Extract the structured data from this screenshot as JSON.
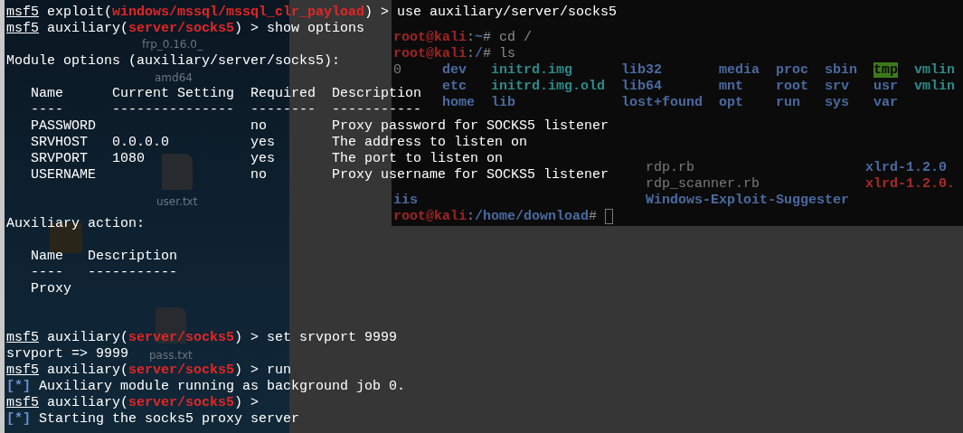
{
  "desktop": {
    "items": [
      {
        "kind": "none",
        "label": [
          "frp_0.16.0_"
        ]
      },
      {
        "kind": "none",
        "label": [
          "amd64"
        ]
      },
      {
        "kind": "file",
        "label": [
          "user.txt"
        ]
      },
      {
        "kind": "folder"
      },
      {
        "kind": "file",
        "label": [
          "pass.txt"
        ]
      }
    ]
  },
  "background_terminal": {
    "lines": [
      {
        "kind": "blank"
      },
      {
        "kind": "blank"
      },
      {
        "kind": "prompt",
        "user": "root@kali",
        "separator": ":",
        "path": "~",
        "command": "# cd /"
      },
      {
        "kind": "prompt",
        "user": "root@kali",
        "separator": ":",
        "path": "/",
        "command": "# ls"
      },
      {
        "kind": "grid",
        "rows": [
          {
            "column_1": {
              "text": "0",
              "kind": "file"
            },
            "column_2": {
              "text": "dev",
              "kind": "dir"
            },
            "column_3": {
              "text": "initrd.img",
              "kind": "link"
            },
            "column_4": {
              "text": "lib32",
              "kind": "dir"
            },
            "column_5": {
              "text": "media",
              "kind": "dir"
            },
            "column_6": {
              "text": "proc",
              "kind": "dir"
            },
            "column_7": {
              "text": "sbin",
              "kind": "dir"
            },
            "column_8": {
              "text": "tmp",
              "kind": "sticky"
            },
            "column_9": {
              "text": "vmlin",
              "kind": "link"
            }
          },
          {
            "column_2": {
              "text": "etc",
              "kind": "dir"
            },
            "column_3": {
              "text": "initrd.img.old",
              "kind": "link"
            },
            "column_4": {
              "text": "lib64",
              "kind": "dir"
            },
            "column_5": {
              "text": "mnt",
              "kind": "dir"
            },
            "column_6": {
              "text": "root",
              "kind": "dir"
            },
            "column_7": {
              "text": "srv",
              "kind": "dir"
            },
            "column_8": {
              "text": "usr",
              "kind": "dir"
            },
            "column_9": {
              "text": "vmlin",
              "kind": "link"
            }
          },
          {
            "column_2": {
              "text": "home",
              "kind": "dir"
            },
            "column_3": {
              "text": "lib",
              "kind": "dir"
            },
            "column_4": {
              "text": "lost+found",
              "kind": "dir"
            },
            "column_5": {
              "text": "opt",
              "kind": "dir"
            },
            "column_6": {
              "text": "run",
              "kind": "dir"
            },
            "column_7": {
              "text": "sys",
              "kind": "dir"
            },
            "column_8": {
              "text": "var",
              "kind": "dir"
            }
          }
        ]
      },
      {
        "kind": "blank"
      },
      {
        "kind": "blank"
      },
      {
        "kind": "blank"
      },
      {
        "kind": "grid",
        "rows": [
          {
            "column_2": {
              "text": "rdp.rb",
              "kind": "file"
            },
            "column_3": {
              "text": "xlrd-1.2.0",
              "kind": "dir"
            }
          },
          {
            "column_2": {
              "text": "rdp_scanner.rb",
              "kind": "file"
            },
            "column_3": {
              "text": "xlrd-1.2.0.",
              "kind": "archive"
            }
          },
          {
            "column_1": {
              "text": "iis",
              "kind": "dir"
            },
            "column_2": {
              "text": "Windows-Exploit-Suggester",
              "kind": "dir"
            }
          }
        ]
      },
      {
        "kind": "prompt",
        "user": "root@kali",
        "separator": ":",
        "path": "/home/download",
        "command": "# ",
        "cursor": true
      }
    ]
  },
  "terminal": {
    "lines": [
      {
        "kind": "prompt",
        "prompt": "msf5",
        "before": " exploit(",
        "module": "windows/mssql/mssql_clr_payload",
        "after": ") > use auxiliary/server/socks5"
      },
      {
        "kind": "prompt",
        "prompt": "msf5",
        "before": " auxiliary(",
        "module": "server/socks5",
        "after": ") > show options"
      },
      {
        "kind": "blank"
      },
      {
        "kind": "text",
        "text": "Module options (auxiliary/server/socks5):"
      },
      {
        "kind": "blank"
      },
      {
        "kind": "table",
        "columns": [
          "Name",
          "Current Setting",
          "Required",
          "Description"
        ],
        "rules": [
          "----",
          "---------------",
          "--------",
          "-----------"
        ],
        "rows": [
          [
            "PASSWORD",
            "",
            "no",
            "Proxy password for SOCKS5 listener"
          ],
          [
            "SRVHOST",
            "0.0.0.0",
            "yes",
            "The address to listen on"
          ],
          [
            "SRVPORT",
            "1080",
            "yes",
            "The port to listen on"
          ],
          [
            "USERNAME",
            "",
            "no",
            "Proxy username for SOCKS5 listener"
          ]
        ]
      },
      {
        "kind": "blank"
      },
      {
        "kind": "blank"
      },
      {
        "kind": "text",
        "text": "Auxiliary action:"
      },
      {
        "kind": "blank"
      },
      {
        "kind": "table",
        "columns": [
          "Name",
          "Description"
        ],
        "rules": [
          "----",
          "-----------"
        ],
        "rows": [
          [
            "Proxy",
            ""
          ]
        ]
      },
      {
        "kind": "blank"
      },
      {
        "kind": "blank"
      },
      {
        "kind": "prompt",
        "prompt": "msf5",
        "before": " auxiliary(",
        "module": "server/socks5",
        "after": ") > set srvport 9999"
      },
      {
        "kind": "text",
        "text": "srvport => 9999"
      },
      {
        "kind": "prompt",
        "prompt": "msf5",
        "before": " auxiliary(",
        "module": "server/socks5",
        "after": ") > run"
      },
      {
        "kind": "status",
        "marker": "[*]",
        "text": " Auxiliary module running as background job 0."
      },
      {
        "kind": "prompt",
        "prompt": "msf5",
        "before": " auxiliary(",
        "module": "server/socks5",
        "after": ") >"
      },
      {
        "kind": "status",
        "marker": "[*]",
        "text": " Starting the socks5 proxy server"
      }
    ]
  }
}
